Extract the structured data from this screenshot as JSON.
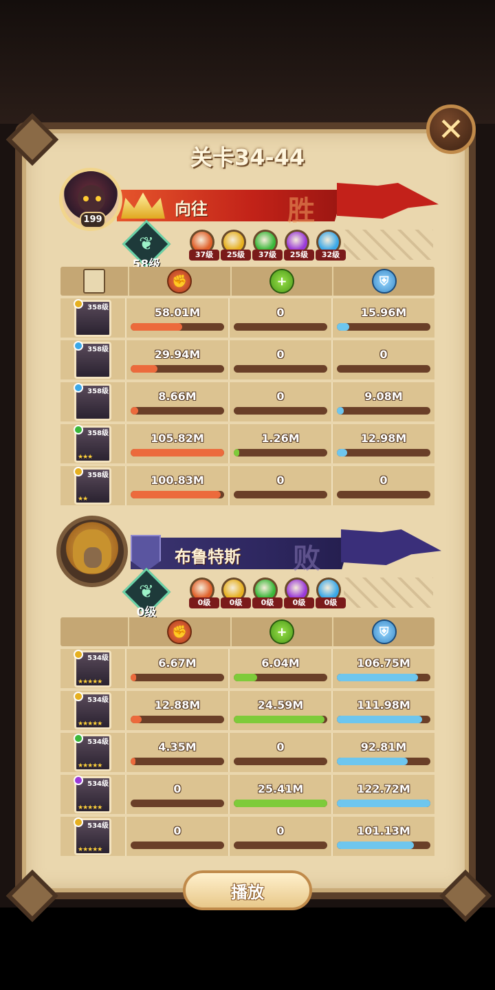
{
  "title": "关卡34-44",
  "colors": {
    "damage": "#ec6a3c",
    "heal": "#7ecb3a",
    "defense": "#6ec6ee"
  },
  "icons": {
    "close": "close-icon",
    "damage": "damage-icon",
    "heal": "heal-icon",
    "defense": "shield-icon",
    "doc": "scroll-icon"
  },
  "attacker": {
    "name": "向往",
    "result": "胜",
    "avatar_level": "199",
    "tree_level": "58级",
    "factions": [
      {
        "icon": "lightbearer-icon",
        "level": "37级",
        "color": "#e0602a"
      },
      {
        "icon": "mauler-icon",
        "level": "25级",
        "color": "#e6b020"
      },
      {
        "icon": "wilder-icon",
        "level": "37级",
        "color": "#3ab83a"
      },
      {
        "icon": "graveborn-icon",
        "level": "25级",
        "color": "#9a3ad8"
      },
      {
        "icon": "celestial-icon",
        "level": "32级",
        "color": "#3aa8e8"
      }
    ],
    "heroes": [
      {
        "level": "358级",
        "stars": "",
        "damage": "58.01M",
        "heal": "0",
        "defense": "15.96M",
        "dmg_pct": 0.55,
        "heal_pct": 0,
        "def_pct": 0.13,
        "faction_color": "#e6b020"
      },
      {
        "level": "358级",
        "stars": "",
        "damage": "29.94M",
        "heal": "0",
        "defense": "0",
        "dmg_pct": 0.29,
        "heal_pct": 0,
        "def_pct": 0,
        "faction_color": "#3aa8e8"
      },
      {
        "level": "358级",
        "stars": "",
        "damage": "8.66M",
        "heal": "0",
        "defense": "9.08M",
        "dmg_pct": 0.08,
        "heal_pct": 0,
        "def_pct": 0.07,
        "faction_color": "#3aa8e8"
      },
      {
        "level": "358级",
        "stars": "★★★",
        "damage": "105.82M",
        "heal": "1.26M",
        "defense": "12.98M",
        "dmg_pct": 1.0,
        "heal_pct": 0.06,
        "def_pct": 0.11,
        "faction_color": "#3ab83a"
      },
      {
        "level": "358级",
        "stars": "★★",
        "damage": "100.83M",
        "heal": "0",
        "defense": "0",
        "dmg_pct": 0.96,
        "heal_pct": 0,
        "def_pct": 0,
        "faction_color": "#e6b020"
      }
    ]
  },
  "defender": {
    "name": "布鲁特斯",
    "result": "败",
    "tree_level": "0级",
    "factions": [
      {
        "icon": "lightbearer-icon",
        "level": "0级",
        "color": "#e0602a"
      },
      {
        "icon": "mauler-icon",
        "level": "0级",
        "color": "#e6b020"
      },
      {
        "icon": "wilder-icon",
        "level": "0级",
        "color": "#3ab83a"
      },
      {
        "icon": "graveborn-icon",
        "level": "0级",
        "color": "#9a3ad8"
      },
      {
        "icon": "celestial-icon",
        "level": "0级",
        "color": "#3aa8e8"
      }
    ],
    "heroes": [
      {
        "level": "534级",
        "stars": "★★★★★",
        "damage": "6.67M",
        "heal": "6.04M",
        "defense": "106.75M",
        "dmg_pct": 0.06,
        "heal_pct": 0.25,
        "def_pct": 0.87,
        "faction_color": "#e6b020"
      },
      {
        "level": "534级",
        "stars": "★★★★★",
        "damage": "12.88M",
        "heal": "24.59M",
        "defense": "111.98M",
        "dmg_pct": 0.12,
        "heal_pct": 0.97,
        "def_pct": 0.91,
        "faction_color": "#e6b020"
      },
      {
        "level": "534级",
        "stars": "★★★★★",
        "damage": "4.35M",
        "heal": "0",
        "defense": "92.81M",
        "dmg_pct": 0.04,
        "heal_pct": 0,
        "def_pct": 0.76,
        "faction_color": "#3ab83a"
      },
      {
        "level": "534级",
        "stars": "★★★★★",
        "damage": "0",
        "heal": "25.41M",
        "defense": "122.72M",
        "dmg_pct": 0,
        "heal_pct": 1.0,
        "def_pct": 1.0,
        "faction_color": "#9a3ad8"
      },
      {
        "level": "534级",
        "stars": "★★★★★",
        "damage": "0",
        "heal": "0",
        "defense": "101.13M",
        "dmg_pct": 0,
        "heal_pct": 0,
        "def_pct": 0.82,
        "faction_color": "#e6b020"
      }
    ]
  },
  "play_label": "播放"
}
